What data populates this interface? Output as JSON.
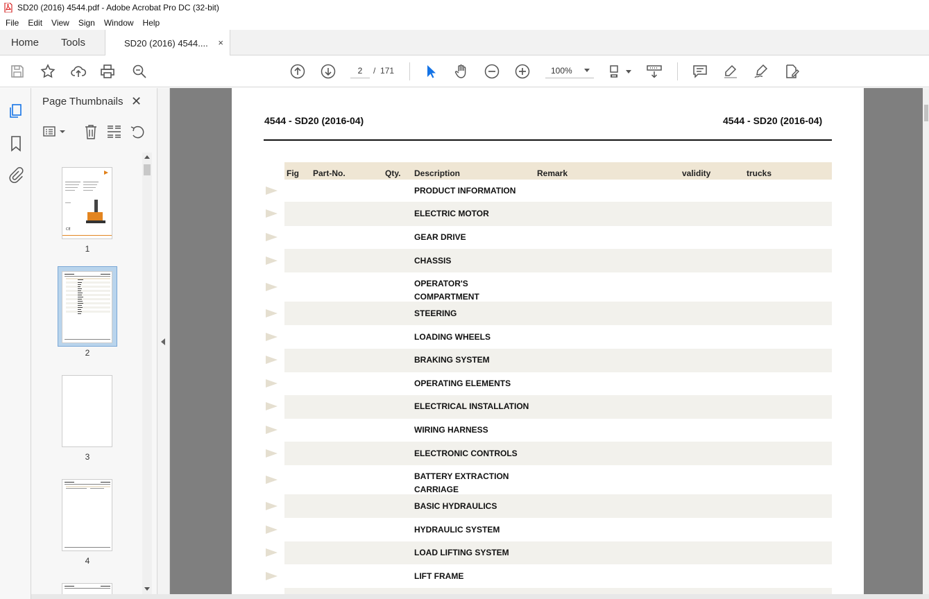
{
  "window": {
    "title": "SD20 (2016) 4544.pdf - Adobe Acrobat Pro DC (32-bit)"
  },
  "menu": [
    "File",
    "Edit",
    "View",
    "Sign",
    "Window",
    "Help"
  ],
  "tabs": {
    "home": "Home",
    "tools": "Tools",
    "document": "SD20 (2016) 4544....",
    "close": "×"
  },
  "toolbar": {
    "page_current": "2",
    "page_separator": "/",
    "page_total": "171",
    "zoom": "100%",
    "icons": [
      "save-icon",
      "bookmark-star-icon",
      "upload-icon",
      "print-icon",
      "zoom-search-icon",
      "page-up-icon",
      "page-down-icon",
      "select-arrow-icon",
      "hand-tool-icon",
      "zoom-out-icon",
      "zoom-in-icon",
      "page-layout-icon",
      "scroll-mode-icon",
      "comment-icon",
      "highlight-icon",
      "sign-icon",
      "edit-icon"
    ]
  },
  "thumbnails_panel": {
    "title": "Page Thumbnails",
    "close": "✕",
    "pages": [
      "1",
      "2",
      "3",
      "4"
    ],
    "selected_page": "2"
  },
  "document": {
    "header_left": "4544 - SD20 (2016-04)",
    "header_right": "4544 - SD20 (2016-04)",
    "columns": [
      "Fig",
      "Part-No.",
      "Qty.",
      "Description",
      "Remark",
      "validity",
      "trucks"
    ],
    "rows": [
      "PRODUCT INFORMATION",
      "ELECTRIC MOTOR",
      "GEAR DRIVE",
      "CHASSIS",
      "OPERATOR'S COMPARTMENT",
      "STEERING",
      "LOADING WHEELS",
      "BRAKING SYSTEM",
      "OPERATING ELEMENTS",
      "ELECTRICAL INSTALLATION",
      "WIRING HARNESS",
      "ELECTRONIC CONTROLS",
      "BATTERY EXTRACTION CARRIAGE",
      "BASIC HYDRAULICS",
      "HYDRAULIC SYSTEM",
      "LOAD LIFTING SYSTEM",
      "LIFT FRAME"
    ]
  },
  "colors": {
    "table_header": "#efe6d4",
    "row_shade": "#f2f1ec",
    "doc_background": "#7f7f7f",
    "accent_blue": "#1473e6"
  }
}
